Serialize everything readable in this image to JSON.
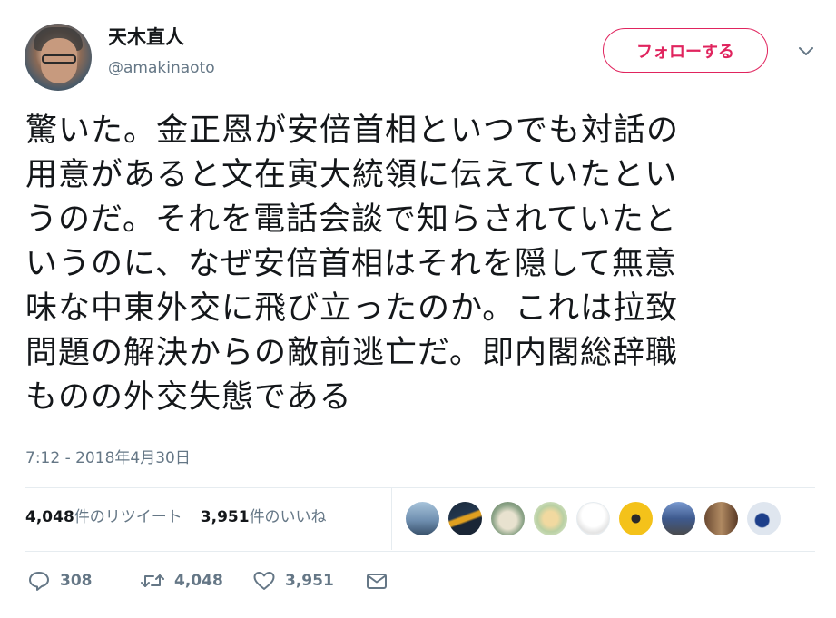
{
  "header": {
    "display_name": "天木直人",
    "handle": "@amakinaoto",
    "follow_label": "フォローする"
  },
  "tweet": {
    "lines": [
      "驚いた。金正恩が安倍首相といつでも対話の",
      "用意があると文在寅大統領に伝えていたとい",
      "うのだ。それを電話会談で知らされていたと",
      "いうのに、なぜ安倍首相はそれを隠して無意",
      "味な中東外交に飛び立ったのか。これは拉致",
      "問題の解決からの敵前逃亡だ。即内閣総辞職",
      "ものの外交失態である"
    ],
    "timestamp": "7:12 - 2018年4月30日"
  },
  "stats": {
    "retweets_count": "4,048",
    "retweets_label": "件のリツイート",
    "likes_count": "3,951",
    "likes_label": "件のいいね"
  },
  "actions": {
    "reply_count": "308",
    "retweet_count": "4,048",
    "like_count": "3,951"
  },
  "colors": {
    "accent": "#e0245e",
    "secondary_text": "#657786",
    "primary_text": "#14171a",
    "divider": "#e6ecf0"
  }
}
